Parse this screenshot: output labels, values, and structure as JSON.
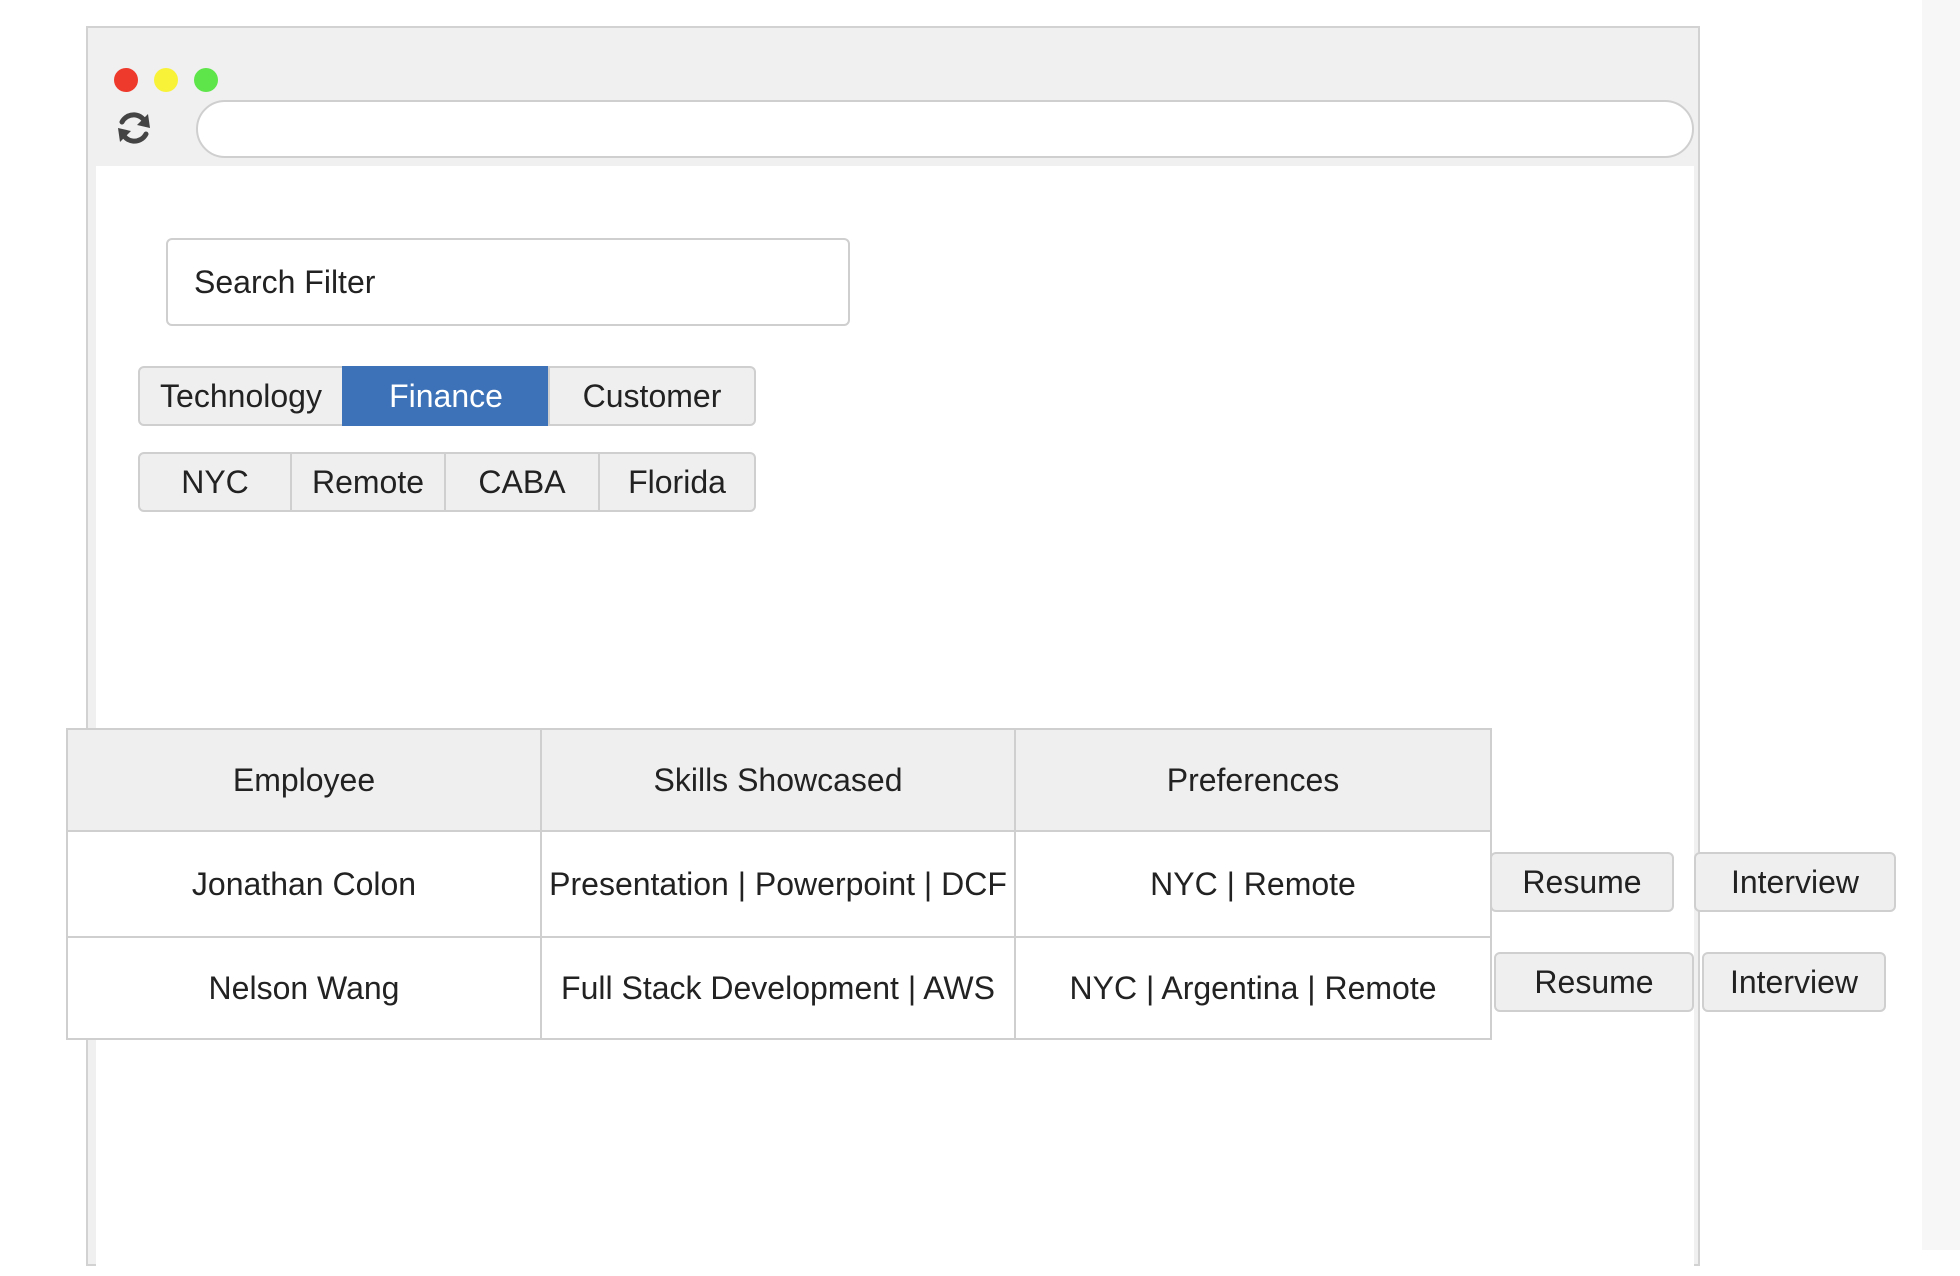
{
  "browser": {
    "address_value": "",
    "traffic_lights": {
      "close_color": "#ee3a2c",
      "minimize_color": "#f8f338",
      "maximize_color": "#5ee54a"
    }
  },
  "search": {
    "placeholder": "Search Filter",
    "value": ""
  },
  "category_filters": [
    {
      "label": "Technology",
      "active": false
    },
    {
      "label": "Finance",
      "active": true
    },
    {
      "label": "Customer",
      "active": false
    }
  ],
  "location_filters": [
    {
      "label": "NYC"
    },
    {
      "label": "Remote"
    },
    {
      "label": "CABA"
    },
    {
      "label": "Florida"
    }
  ],
  "table": {
    "headers": [
      "Employee",
      "Skills Showcased",
      "Preferences"
    ],
    "rows": [
      {
        "employee": "Jonathan Colon",
        "skills": "Presentation | Powerpoint | DCF",
        "preferences": "NYC | Remote",
        "resume_label": "Resume",
        "interview_label": "Interview"
      },
      {
        "employee": "Nelson Wang",
        "skills": "Full Stack Development | AWS",
        "preferences": "NYC | Argentina | Remote",
        "resume_label": "Resume",
        "interview_label": "Interview"
      }
    ]
  },
  "colors": {
    "active_filter": "#3d72b8",
    "button_bg": "#efefef",
    "border": "#cfcfcf"
  }
}
